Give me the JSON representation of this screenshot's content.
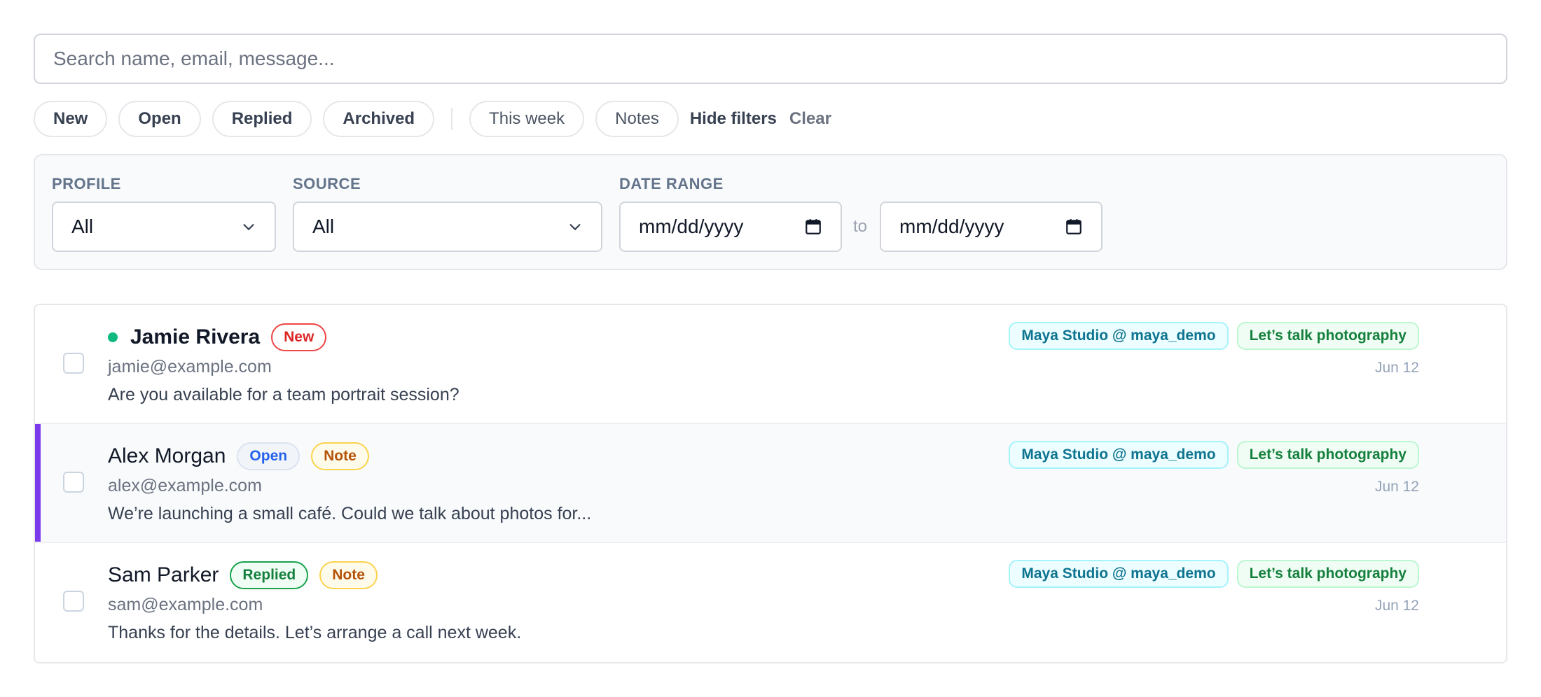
{
  "search": {
    "placeholder": "Search name, email, message..."
  },
  "chips": {
    "status": [
      "New",
      "Open",
      "Replied",
      "Archived"
    ],
    "this_week": "This week",
    "notes": "Notes",
    "hide_filters": "Hide filters",
    "clear": "Clear"
  },
  "filters": {
    "profile": {
      "label": "PROFILE",
      "value": "All"
    },
    "source": {
      "label": "SOURCE",
      "value": "All"
    },
    "date_range": {
      "label": "DATE RANGE",
      "from": "mm/dd/yyyy",
      "to_label": "to",
      "to": "mm/dd/yyyy"
    }
  },
  "messages": [
    {
      "name": "Jamie Rivera",
      "unread": true,
      "status": "New",
      "note": null,
      "email": "jamie@example.com",
      "message": "Are you available for a team portrait session?",
      "profile_tag": "Maya Studio @ maya_demo",
      "source_tag": "Let’s talk photography",
      "date": "Jun 12"
    },
    {
      "name": "Alex Morgan",
      "unread": false,
      "status": "Open",
      "note": "Note",
      "email": "alex@example.com",
      "message": "We’re launching a small café. Could we talk about photos for...",
      "profile_tag": "Maya Studio @ maya_demo",
      "source_tag": "Let’s talk photography",
      "date": "Jun 12"
    },
    {
      "name": "Sam Parker",
      "unread": false,
      "status": "Replied",
      "note": "Note",
      "email": "sam@example.com",
      "message": "Thanks for the details. Let’s arrange a call next week.",
      "profile_tag": "Maya Studio @ maya_demo",
      "source_tag": "Let’s talk photography",
      "date": "Jun 12"
    }
  ],
  "colors": {
    "accent": "#7c3aed",
    "unread_dot": "#10b981",
    "new": "#dc2626",
    "open": "#2563eb",
    "replied": "#15803d",
    "note": "#b45309"
  },
  "icons": {
    "select_arrow": "chevron-down-icon",
    "date_picker": "calendar-icon"
  }
}
